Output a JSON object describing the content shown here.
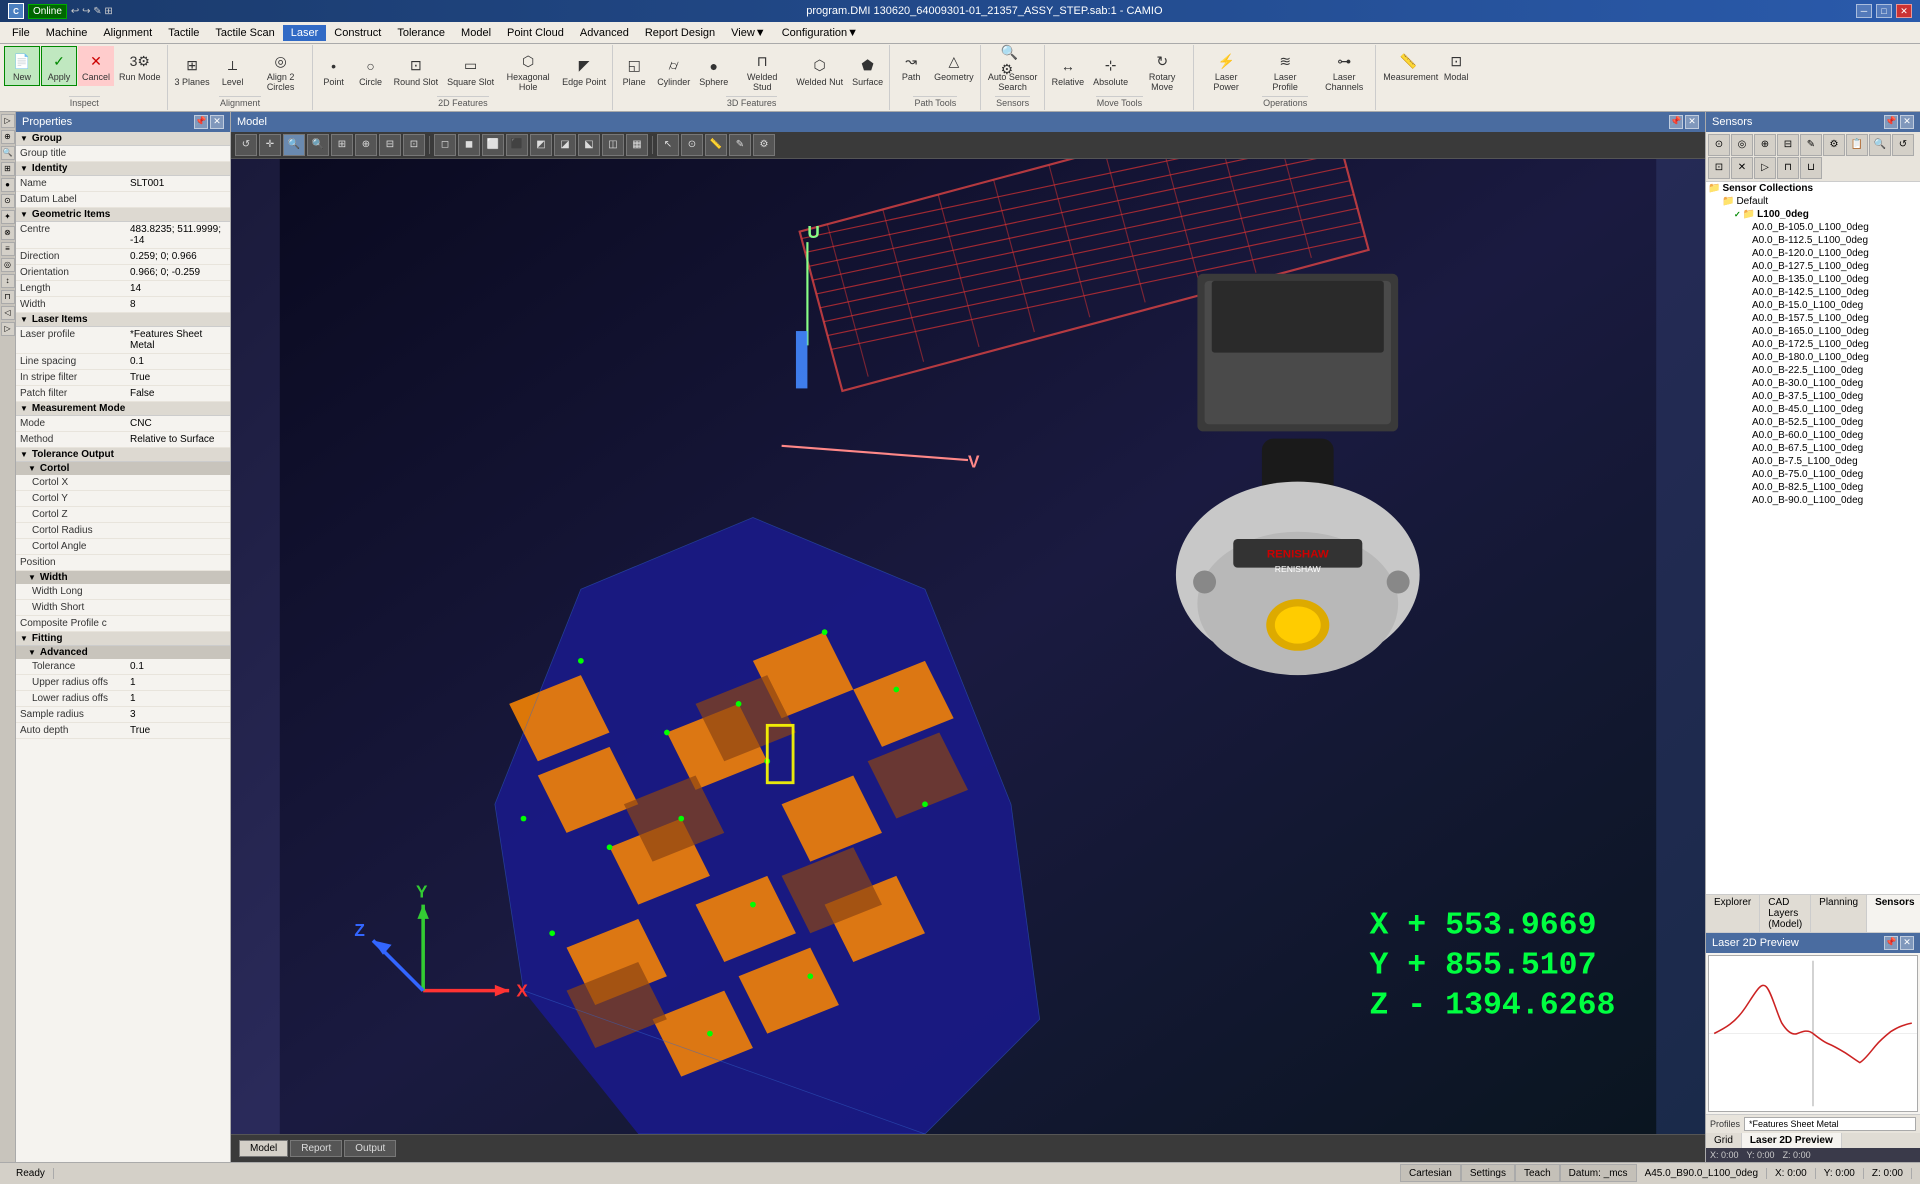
{
  "titlebar": {
    "title": "program.DMI 130620_64009301-01_21357_ASSY_STEP.sab:1 - CAMIO",
    "app_icon": "C",
    "online": "Online",
    "controls": [
      "─",
      "□",
      "✕"
    ]
  },
  "menubar": {
    "items": [
      "File",
      "Machine",
      "Alignment",
      "Tactile",
      "Tactile Scan",
      "Laser",
      "Construct",
      "Tolerance",
      "Model",
      "Point Cloud",
      "Advanced",
      "Report Design",
      "View▼",
      "Configuration▼"
    ]
  },
  "toolbar": {
    "inspect_group": {
      "label": "Inspect",
      "buttons": [
        "New",
        "Apply",
        "Cancel",
        "Run Mode"
      ]
    },
    "alignment_group": {
      "label": "Alignment",
      "buttons": [
        "3 Planes",
        "Level",
        "Align 2 Circles"
      ]
    },
    "point_btn": "Point",
    "circle_btn": "Circle",
    "round_slot_btn": "Round Slot",
    "square_slot_btn": "Square Slot",
    "hexagonal_hole_btn": "Hexagonal Hole",
    "edge_point_btn": "Edge Point",
    "features_2d_label": "2D Features",
    "plane_btn": "Plane",
    "cylinder_btn": "Cylinder",
    "sphere_btn": "Sphere",
    "welded_stud_btn": "Welded Stud",
    "welded_nut_btn": "Welded Nut",
    "surface_btn": "Surface",
    "features_3d_label": "3D Features",
    "path_btn": "Path",
    "geometry_btn": "Geometry",
    "path_tools_label": "Path Tools",
    "auto_sensor_btn": "Auto Sensor Search",
    "sensors_label": "Sensors",
    "relative_btn": "Relative",
    "absolute_btn": "Absolute",
    "rotary_move_btn": "Rotary Move",
    "move_tools_label": "Move Tools",
    "laser_power_btn": "Laser Power",
    "laser_profile_btn": "Laser Profile",
    "laser_channels_btn": "Laser Channels",
    "operations_label": "Operations",
    "measurement_btn": "Measurement",
    "modal_btn": "Modal"
  },
  "properties": {
    "title": "Properties",
    "sections": {
      "group": {
        "label": "Group",
        "rows": [
          {
            "label": "Group title",
            "value": ""
          }
        ]
      },
      "identity": {
        "label": "Identity",
        "rows": [
          {
            "label": "Name",
            "value": "SLT001"
          },
          {
            "label": "Datum Label",
            "value": ""
          }
        ]
      },
      "geometric_items": {
        "label": "Geometric Items",
        "rows": [
          {
            "label": "Centre",
            "value": "483.8235; 511.9999; -14"
          },
          {
            "label": "Direction",
            "value": "0.259; 0; 0.966"
          },
          {
            "label": "Orientation",
            "value": "0.966; 0; -0.259"
          },
          {
            "label": "Length",
            "value": "14"
          },
          {
            "label": "Width",
            "value": "8"
          }
        ]
      },
      "laser_items": {
        "label": "Laser Items",
        "rows": [
          {
            "label": "Laser profile",
            "value": "*Features Sheet Metal"
          },
          {
            "label": "Line spacing",
            "value": "0.1"
          },
          {
            "label": "In stripe filter",
            "value": "True"
          },
          {
            "label": "Patch filter",
            "value": "False"
          }
        ]
      },
      "measurement_mode": {
        "label": "Measurement Mode",
        "rows": [
          {
            "label": "Mode",
            "value": "CNC"
          },
          {
            "label": "Method",
            "value": "Relative to Surface"
          }
        ]
      },
      "tolerance_output": {
        "label": "Tolerance Output",
        "cortol": {
          "label": "Cortol",
          "rows": [
            {
              "label": "Cortol X",
              "value": ""
            },
            {
              "label": "Cortol Y",
              "value": ""
            },
            {
              "label": "Cortol Z",
              "value": ""
            },
            {
              "label": "Cortol Radius",
              "value": ""
            },
            {
              "label": "Cortol Angle",
              "value": ""
            }
          ]
        },
        "position_row": {
          "label": "Position",
          "value": ""
        },
        "width": {
          "label": "Width",
          "rows": [
            {
              "label": "Width Long",
              "value": ""
            },
            {
              "label": "Width Short",
              "value": ""
            }
          ]
        },
        "composite_profile_row": {
          "label": "Composite Profile c",
          "value": ""
        }
      },
      "fitting": {
        "label": "Fitting",
        "advanced": {
          "label": "Advanced",
          "rows": [
            {
              "label": "Tolerance",
              "value": "0.1"
            },
            {
              "label": "Upper radius offs",
              "value": "1"
            },
            {
              "label": "Lower radius offs",
              "value": "1"
            }
          ]
        },
        "rows": [
          {
            "label": "Sample radius",
            "value": "3"
          },
          {
            "label": "Auto depth",
            "value": "True"
          }
        ]
      }
    }
  },
  "model": {
    "title": "Model",
    "tabs": [
      "Model",
      "Report",
      "Output"
    ],
    "active_tab": "Model"
  },
  "coordinates": {
    "x_label": "X",
    "x_value": "+ 553.9669",
    "y_label": "Y",
    "y_value": "+ 855.5107",
    "z_label": "Z",
    "z_value": "- 1394.6268"
  },
  "sensors": {
    "title": "Sensors",
    "collections": [
      {
        "name": "Sensor Collections",
        "folders": [
          {
            "name": "Default",
            "items": [
              {
                "name": "L100_0deg",
                "checked": true,
                "sub_items": [
                  "A0.0_B-105.0_L100_0deg",
                  "A0.0_B-112.5_L100_0deg",
                  "A0.0_B-120.0_L100_0deg",
                  "A0.0_B-127.5_L100_0deg",
                  "A0.0_B-135.0_L100_0deg",
                  "A0.0_B-142.5_L100_0deg",
                  "A0.0_B-15.0_L100_0deg",
                  "A0.0_B-157.5_L100_0deg",
                  "A0.0_B-165.0_L100_0deg",
                  "A0.0_B-172.5_L100_0deg",
                  "A0.0_B-180.0_L100_0deg",
                  "A0.0_B-22.5_L100_0deg",
                  "A0.0_B-30.0_L100_0deg",
                  "A0.0_B-37.5_L100_0deg",
                  "A0.0_B-45.0_L100_0deg",
                  "A0.0_B-52.5_L100_0deg",
                  "A0.0_B-60.0_L100_0deg",
                  "A0.0_B-67.5_L100_0deg",
                  "A0.0_B-7.5_L100_0deg",
                  "A0.0_B-75.0_L100_0deg",
                  "A0.0_B-82.5_L100_0deg",
                  "A0.0_B-90.0_L100_0deg"
                ]
              }
            ]
          }
        ]
      }
    ],
    "bottom_tabs": [
      "Explorer",
      "CAD Layers (Model)",
      "Planning",
      "Sensors"
    ],
    "active_tab": "Sensors"
  },
  "laser_preview": {
    "title": "Laser 2D Preview",
    "profiles_label": "Profiles",
    "profiles_value": "*Features Sheet Metal",
    "footer_tabs": [
      "Grid",
      "Laser 2D Preview"
    ],
    "active_tab": "Laser 2D Preview",
    "coords": {
      "x": "X: 0:00",
      "y": "Y: 0:00",
      "z": "Z: 0:00"
    }
  },
  "statusbar": {
    "ready": "Ready",
    "cartesian": "Cartesian",
    "settings": "Settings",
    "teach": "Teach",
    "datum": "Datum: _mcs",
    "sensor": "A45.0_B90.0_L100_0deg",
    "x_coord": "X: 0:00",
    "y_coord": "Y: 0:00",
    "z_coord": "Z: 0:00"
  },
  "model_toolbar_icons": [
    "↺",
    "⊕",
    "🔍",
    "🔍",
    "⊞",
    "⊟",
    "⊡",
    "⊠",
    "⊟",
    "▷",
    "◁",
    "↕",
    "⤢",
    "◻",
    "◼",
    "◈",
    "⬡",
    "⬟",
    "⊕",
    "≋",
    "⊛",
    "⊙",
    "✦",
    "⊗",
    "≡"
  ]
}
